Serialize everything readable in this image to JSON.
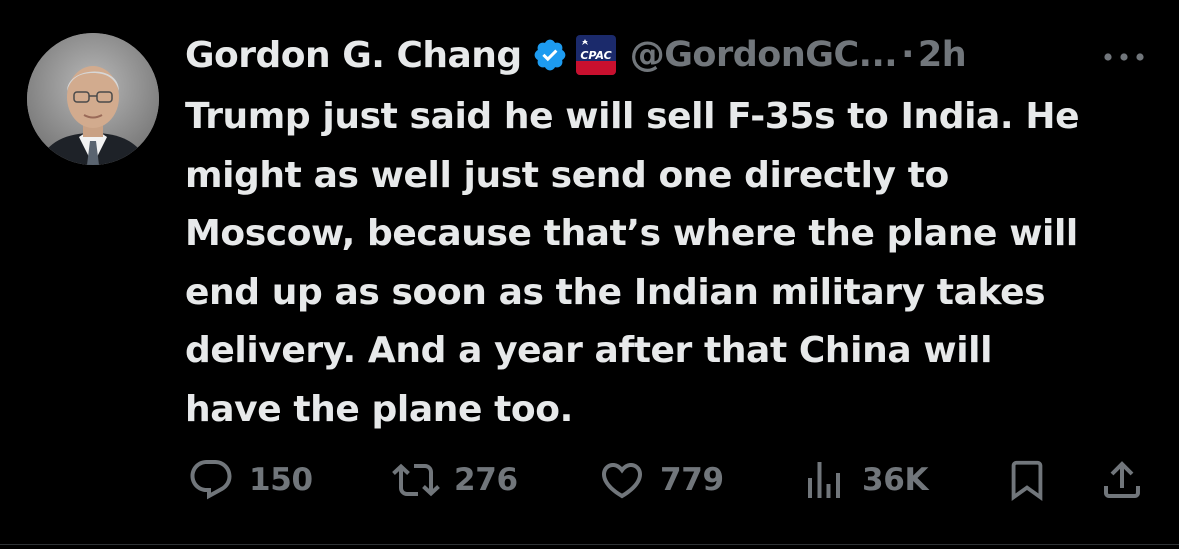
{
  "author": {
    "name": "Gordon G. Chang",
    "handle": "@GordonGC...",
    "separator": "·",
    "time": "2h",
    "affiliate_badge_text": "CPAC"
  },
  "tweet": {
    "lines": [
      "Trump just said he will sell F-35s to India. He",
      "might as well just send one directly to",
      "Moscow, because that’s where the plane will",
      "end up as soon as the Indian military takes",
      "delivery. And a year after that China will",
      "have the plane too."
    ]
  },
  "actions": {
    "replies": "150",
    "reposts": "276",
    "likes": "779",
    "views": "36K"
  },
  "icons": {
    "verified": "verified-badge-icon",
    "more": "more-options-icon",
    "reply": "reply-icon",
    "repost": "repost-icon",
    "like": "heart-icon",
    "views": "views-chart-icon",
    "bookmark": "bookmark-icon",
    "share": "share-icon"
  },
  "colors": {
    "background": "#000000",
    "text": "#e7e9ea",
    "secondary": "#71767b",
    "verified": "#1d9bf0"
  }
}
